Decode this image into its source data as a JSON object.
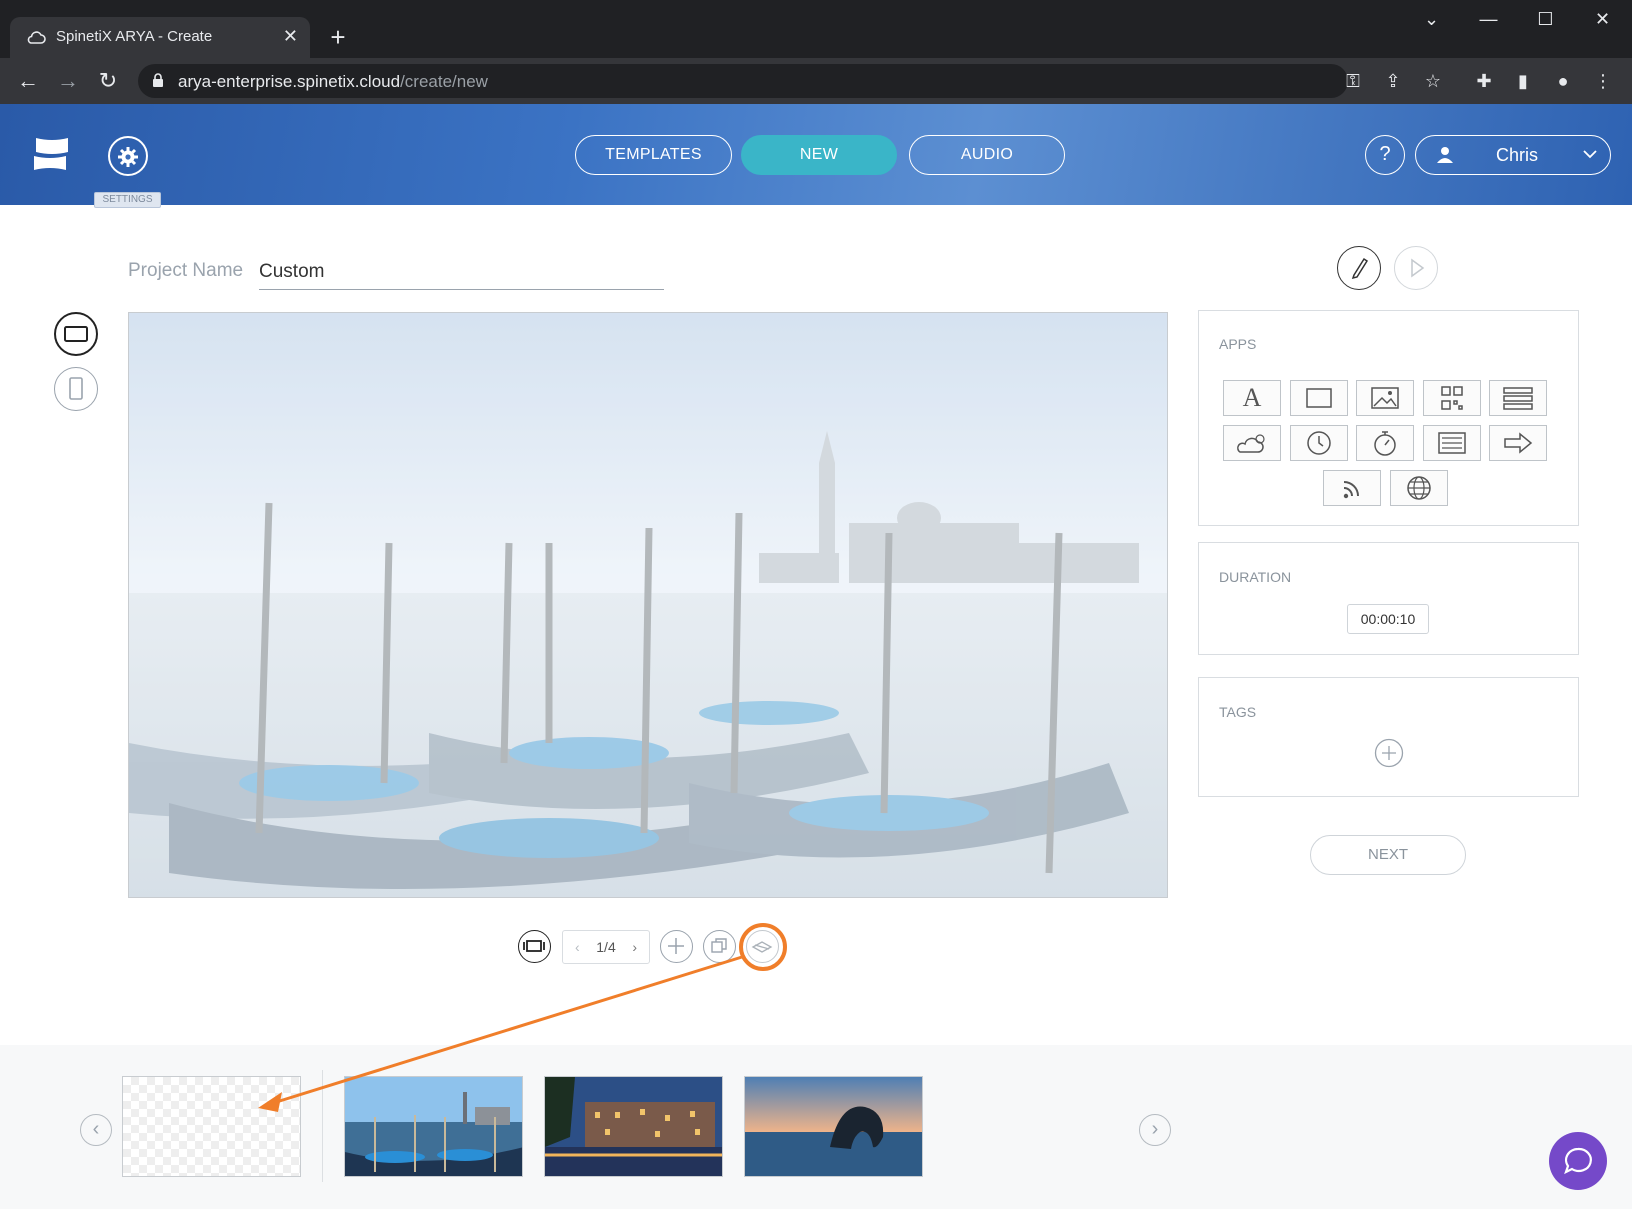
{
  "browser": {
    "tab_title": "SpinetiX ARYA - Create",
    "url_host": "arya-enterprise.spinetix.cloud",
    "url_path": "/create/new"
  },
  "header": {
    "settings_tooltip": "SETTINGS",
    "nav": [
      "TEMPLATES",
      "NEW",
      "AUDIO"
    ],
    "active_nav": "NEW",
    "help_label": "?",
    "user_name": "Chris"
  },
  "project": {
    "name_label": "Project Name",
    "name_value": "Custom"
  },
  "apps_panel": {
    "title": "APPS",
    "apps": [
      "text-app-icon",
      "shape-app-icon",
      "image-app-icon",
      "qr-code-app-icon",
      "list-app-icon",
      "weather-app-icon",
      "clock-app-icon",
      "countdown-app-icon",
      "ticker-app-icon",
      "arrow-app-icon",
      "rss-app-icon",
      "web-app-icon"
    ]
  },
  "duration_panel": {
    "title": "DURATION",
    "value": "00:00:10"
  },
  "tags_panel": {
    "title": "TAGS"
  },
  "next_label": "NEXT",
  "slide_pager": "1/4",
  "colors": {
    "accent": "#3ab5c8",
    "highlight": "#f07e2a",
    "chat": "#7549c9"
  }
}
